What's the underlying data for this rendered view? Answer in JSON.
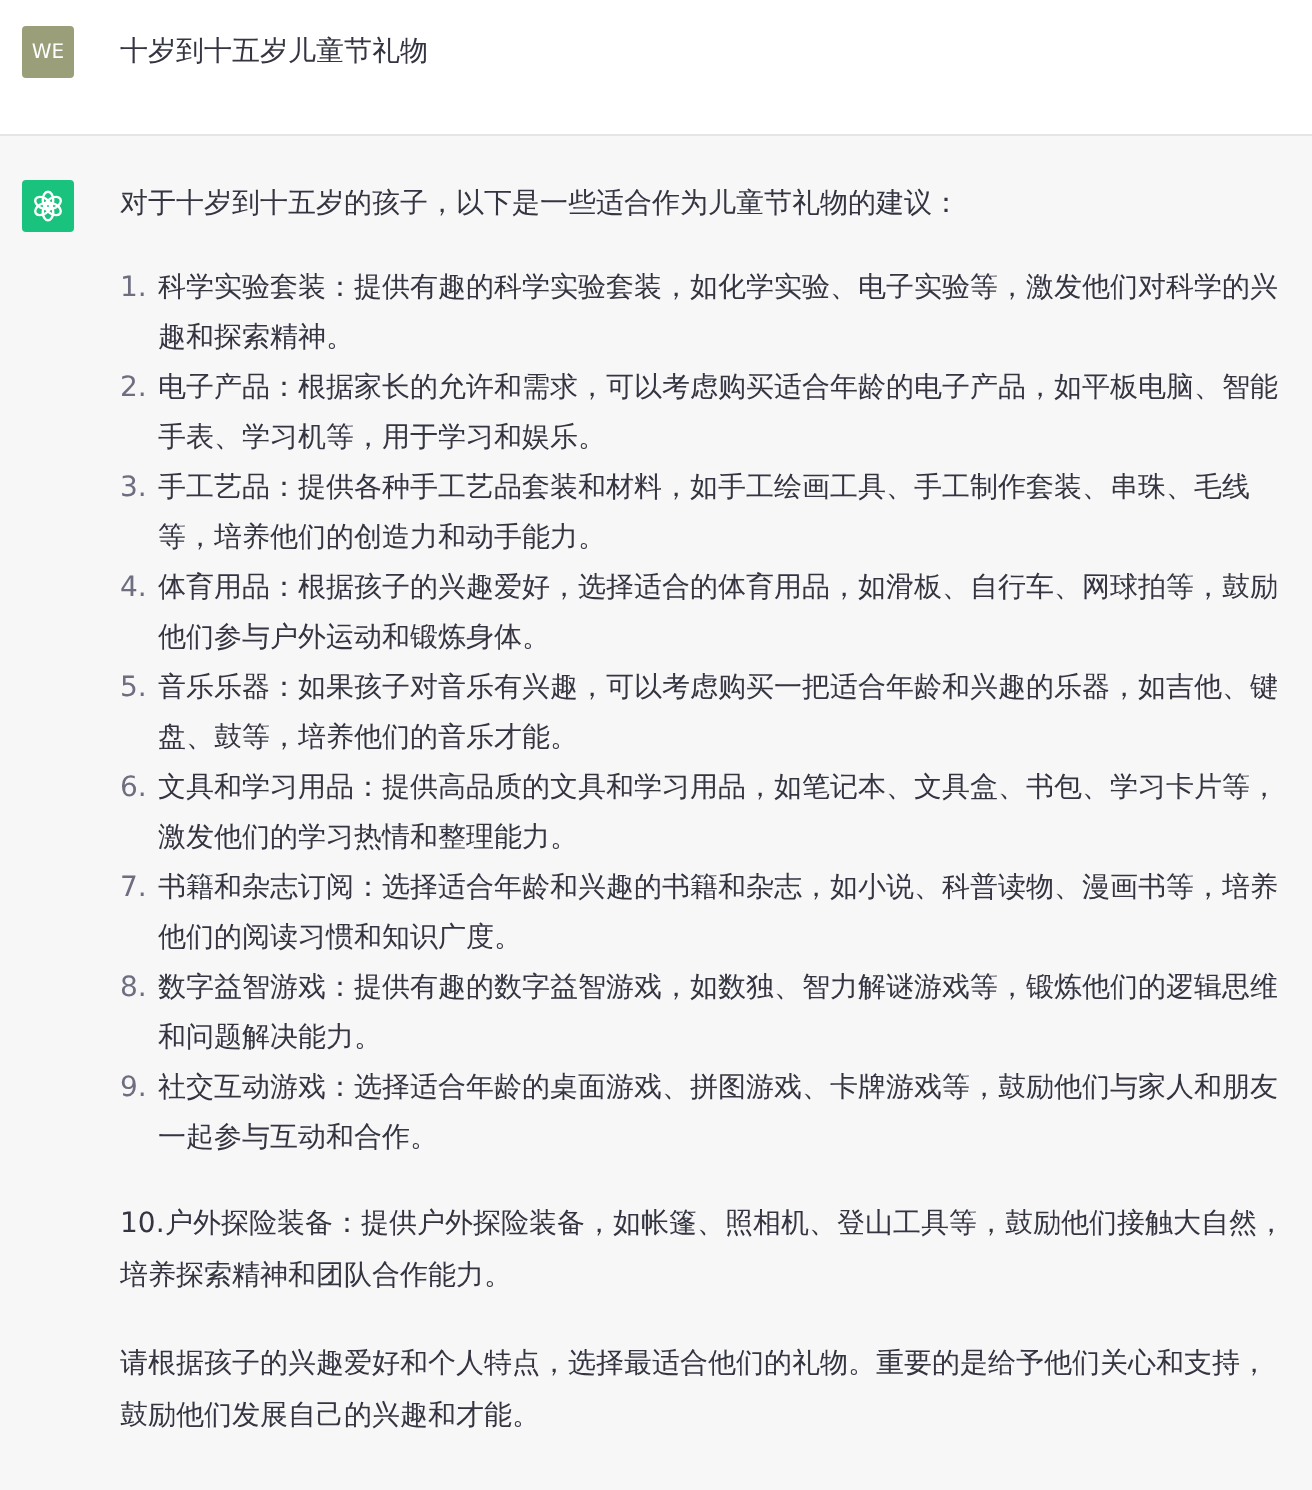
{
  "user_message": {
    "avatar": "WE",
    "text": "十岁到十五岁儿童节礼物"
  },
  "assistant_message": {
    "intro": "对于十岁到十五岁的孩子，以下是一些适合作为儿童节礼物的建议：",
    "items": [
      {
        "number": "1.",
        "text": "科学实验套装：提供有趣的科学实验套装，如化学实验、电子实验等，激发他们对科学的兴趣和探索精神。"
      },
      {
        "number": "2.",
        "text": "电子产品：根据家长的允许和需求，可以考虑购买适合年龄的电子产品，如平板电脑、智能手表、学习机等，用于学习和娱乐。"
      },
      {
        "number": "3.",
        "text": "手工艺品：提供各种手工艺品套装和材料，如手工绘画工具、手工制作套装、串珠、毛线等，培养他们的创造力和动手能力。"
      },
      {
        "number": "4.",
        "text": "体育用品：根据孩子的兴趣爱好，选择适合的体育用品，如滑板、自行车、网球拍等，鼓励他们参与户外运动和锻炼身体。"
      },
      {
        "number": "5.",
        "text": "音乐乐器：如果孩子对音乐有兴趣，可以考虑购买一把适合年龄和兴趣的乐器，如吉他、键盘、鼓等，培养他们的音乐才能。"
      },
      {
        "number": "6.",
        "text": "文具和学习用品：提供高品质的文具和学习用品，如笔记本、文具盒、书包、学习卡片等，激发他们的学习热情和整理能力。"
      },
      {
        "number": "7.",
        "text": "书籍和杂志订阅：选择适合年龄和兴趣的书籍和杂志，如小说、科普读物、漫画书等，培养他们的阅读习惯和知识广度。"
      },
      {
        "number": "8.",
        "text": "数字益智游戏：提供有趣的数字益智游戏，如数独、智力解谜游戏等，锻炼他们的逻辑思维和问题解决能力。"
      },
      {
        "number": "9.",
        "text": "社交互动游戏：选择适合年龄的桌面游戏、拼图游戏、卡牌游戏等，鼓励他们与家人和朋友一起参与互动和合作。"
      }
    ],
    "paragraphs": [
      "10.户外探险装备：提供户外探险装备，如帐篷、照相机、登山工具等，鼓励他们接触大自然，培养探索精神和团队合作能力。",
      "请根据孩子的兴趣爱好和个人特点，选择最适合他们的礼物。重要的是给予他们关心和支持，鼓励他们发展自己的兴趣和才能。"
    ]
  }
}
